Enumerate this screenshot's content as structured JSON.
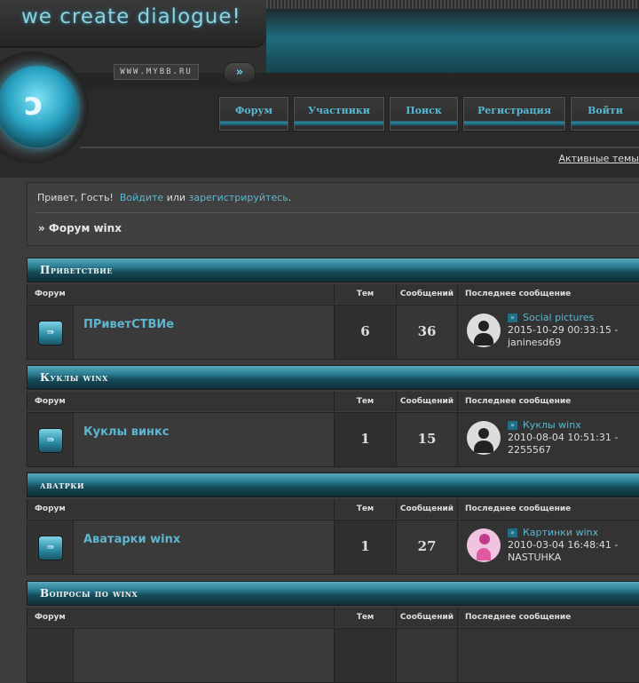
{
  "header": {
    "slogan": "we create dialogue!",
    "url": "WWW.MYBB.RU",
    "go": "»",
    "logo_glyph": "ↄ"
  },
  "nav": [
    "Форум",
    "Участники",
    "Поиск",
    "Регистрация",
    "Войти"
  ],
  "active_topics": "Активные темы",
  "welcome": {
    "greeting": "Привет, Гость!",
    "login": "Войдите",
    "or": "или",
    "register": "зарегистрируйтесь",
    "dot": ".",
    "crumb": "» Форум winx"
  },
  "columns": {
    "forum": "Форум",
    "topics": "Тем",
    "posts": "Сообщений",
    "last": "Последнее сообщение"
  },
  "categories": [
    {
      "title": "Приветствие",
      "forum": "ПРиветСТВИе",
      "topics": "6",
      "posts": "36",
      "last_title": "Social pictures",
      "last_date": "2015-10-29 00:33:15 -",
      "last_user": "janinesd69",
      "avatar": "default"
    },
    {
      "title": "Куклы winx",
      "forum": "Куклы винкс",
      "topics": "1",
      "posts": "15",
      "last_title": "Куклы winx",
      "last_date": "2010-08-04 10:51:31 -",
      "last_user": "2255567",
      "avatar": "default"
    },
    {
      "title": "аватрки",
      "forum": "Аватарки winx",
      "topics": "1",
      "posts": "27",
      "last_title": "Картинки winx",
      "last_date": "2010-03-04 16:48:41 -",
      "last_user": "NASTUHKA",
      "avatar": "pink"
    },
    {
      "title": "Вопросы по winx"
    }
  ]
}
